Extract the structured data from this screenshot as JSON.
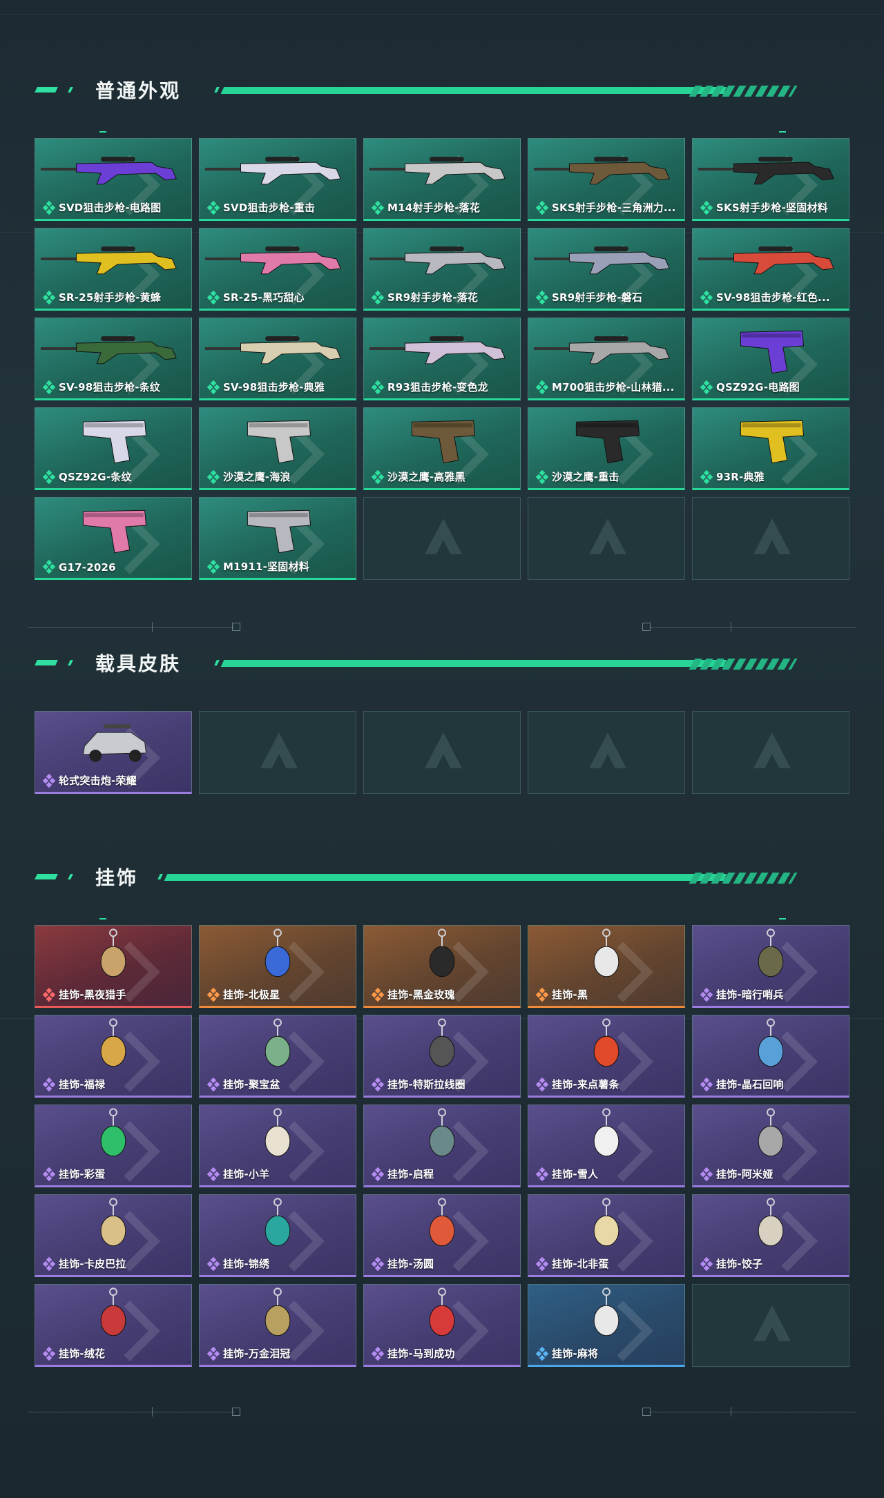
{
  "sections": {
    "weapons": {
      "title": "普通外观"
    },
    "vehicles": {
      "title": "载具皮肤"
    },
    "charms": {
      "title": "挂饰"
    }
  },
  "colors": {
    "accent": "#28d89a",
    "green_card": "#1f6659",
    "purple_card": "#463d72",
    "red_card": "#5e2a37",
    "orange_card": "#63452f",
    "blue_card": "#2a4a6a"
  },
  "weapons": [
    {
      "label": "SVD狙击步枪-电路图",
      "rarity": "green",
      "icon": "rifle-icon"
    },
    {
      "label": "SVD狙击步枪-重击",
      "rarity": "green",
      "icon": "rifle-icon"
    },
    {
      "label": "M14射手步枪-落花",
      "rarity": "green",
      "icon": "rifle-icon"
    },
    {
      "label": "SKS射手步枪-三角洲力...",
      "rarity": "green",
      "icon": "rifle-icon"
    },
    {
      "label": "SKS射手步枪-坚固材料",
      "rarity": "green",
      "icon": "rifle-icon"
    },
    {
      "label": "SR-25射手步枪-黄蜂",
      "rarity": "green",
      "icon": "rifle-icon"
    },
    {
      "label": "SR-25-黑巧甜心",
      "rarity": "green",
      "icon": "rifle-icon"
    },
    {
      "label": "SR9射手步枪-落花",
      "rarity": "green",
      "icon": "rifle-icon"
    },
    {
      "label": "SR9射手步枪-磐石",
      "rarity": "green",
      "icon": "rifle-icon"
    },
    {
      "label": "SV-98狙击步枪-红色...",
      "rarity": "green",
      "icon": "rifle-icon"
    },
    {
      "label": "SV-98狙击步枪-条纹",
      "rarity": "green",
      "icon": "rifle-icon"
    },
    {
      "label": "SV-98狙击步枪-典雅",
      "rarity": "green",
      "icon": "rifle-icon"
    },
    {
      "label": "R93狙击步枪-变色龙",
      "rarity": "green",
      "icon": "rifle-icon"
    },
    {
      "label": "M700狙击步枪-山林猎...",
      "rarity": "green",
      "icon": "rifle-icon"
    },
    {
      "label": "QSZ92G-电路图",
      "rarity": "green",
      "icon": "pistol-icon"
    },
    {
      "label": "QSZ92G-条纹",
      "rarity": "green",
      "icon": "pistol-icon"
    },
    {
      "label": "沙漠之鹰-海浪",
      "rarity": "green",
      "icon": "pistol-icon"
    },
    {
      "label": "沙漠之鹰-高雅黑",
      "rarity": "green",
      "icon": "pistol-icon"
    },
    {
      "label": "沙漠之鹰-重击",
      "rarity": "green",
      "icon": "pistol-icon"
    },
    {
      "label": "93R-典雅",
      "rarity": "green",
      "icon": "pistol-icon"
    },
    {
      "label": "G17-2026",
      "rarity": "green",
      "icon": "pistol-icon"
    },
    {
      "label": "M1911-坚固材料",
      "rarity": "green",
      "icon": "pistol-icon"
    },
    {
      "label": "",
      "rarity": "empty",
      "icon": "empty-slot-logo-icon"
    },
    {
      "label": "",
      "rarity": "empty",
      "icon": "empty-slot-logo-icon"
    },
    {
      "label": "",
      "rarity": "empty",
      "icon": "empty-slot-logo-icon"
    }
  ],
  "vehicles": [
    {
      "label": "轮式突击炮-荣耀",
      "rarity": "purple",
      "icon": "vehicle-icon"
    },
    {
      "label": "",
      "rarity": "empty",
      "icon": "empty-slot-logo-icon"
    },
    {
      "label": "",
      "rarity": "empty",
      "icon": "empty-slot-logo-icon"
    },
    {
      "label": "",
      "rarity": "empty",
      "icon": "empty-slot-logo-icon"
    },
    {
      "label": "",
      "rarity": "empty",
      "icon": "empty-slot-logo-icon"
    }
  ],
  "charms": [
    {
      "label": "挂饰-黑夜猎手",
      "rarity": "red",
      "icon": "charm-icon"
    },
    {
      "label": "挂饰-北极星",
      "rarity": "orange",
      "icon": "charm-icon"
    },
    {
      "label": "挂饰-黑金玫瑰",
      "rarity": "orange",
      "icon": "charm-icon"
    },
    {
      "label": "挂饰-黑",
      "rarity": "orange",
      "icon": "charm-icon"
    },
    {
      "label": "挂饰-暗行哨兵",
      "rarity": "purple",
      "icon": "charm-icon"
    },
    {
      "label": "挂饰-福禄",
      "rarity": "purple",
      "icon": "charm-icon"
    },
    {
      "label": "挂饰-聚宝盆",
      "rarity": "purple",
      "icon": "charm-icon"
    },
    {
      "label": "挂饰-特斯拉线圈",
      "rarity": "purple",
      "icon": "charm-icon"
    },
    {
      "label": "挂饰-来点薯条",
      "rarity": "purple",
      "icon": "charm-icon"
    },
    {
      "label": "挂饰-晶石回响",
      "rarity": "purple",
      "icon": "charm-icon"
    },
    {
      "label": "挂饰-彩蛋",
      "rarity": "purple",
      "icon": "charm-icon"
    },
    {
      "label": "挂饰-小羊",
      "rarity": "purple",
      "icon": "charm-icon"
    },
    {
      "label": "挂饰-启程",
      "rarity": "purple",
      "icon": "charm-icon"
    },
    {
      "label": "挂饰-雪人",
      "rarity": "purple",
      "icon": "charm-icon"
    },
    {
      "label": "挂饰-阿米娅",
      "rarity": "purple",
      "icon": "charm-icon"
    },
    {
      "label": "挂饰-卡皮巴拉",
      "rarity": "purple",
      "icon": "charm-icon"
    },
    {
      "label": "挂饰-锦绣",
      "rarity": "purple",
      "icon": "charm-icon"
    },
    {
      "label": "挂饰-汤圆",
      "rarity": "purple",
      "icon": "charm-icon"
    },
    {
      "label": "挂饰-北非蛋",
      "rarity": "purple",
      "icon": "charm-icon"
    },
    {
      "label": "挂饰-饺子",
      "rarity": "purple",
      "icon": "charm-icon"
    },
    {
      "label": "挂饰-绒花",
      "rarity": "purple",
      "icon": "charm-icon"
    },
    {
      "label": "挂饰-万金泪冠",
      "rarity": "purple",
      "icon": "charm-icon"
    },
    {
      "label": "挂饰-马到成功",
      "rarity": "purple",
      "icon": "charm-icon"
    },
    {
      "label": "挂饰-麻将",
      "rarity": "blue",
      "icon": "charm-icon"
    },
    {
      "label": "",
      "rarity": "empty",
      "icon": "empty-slot-logo-icon"
    }
  ]
}
